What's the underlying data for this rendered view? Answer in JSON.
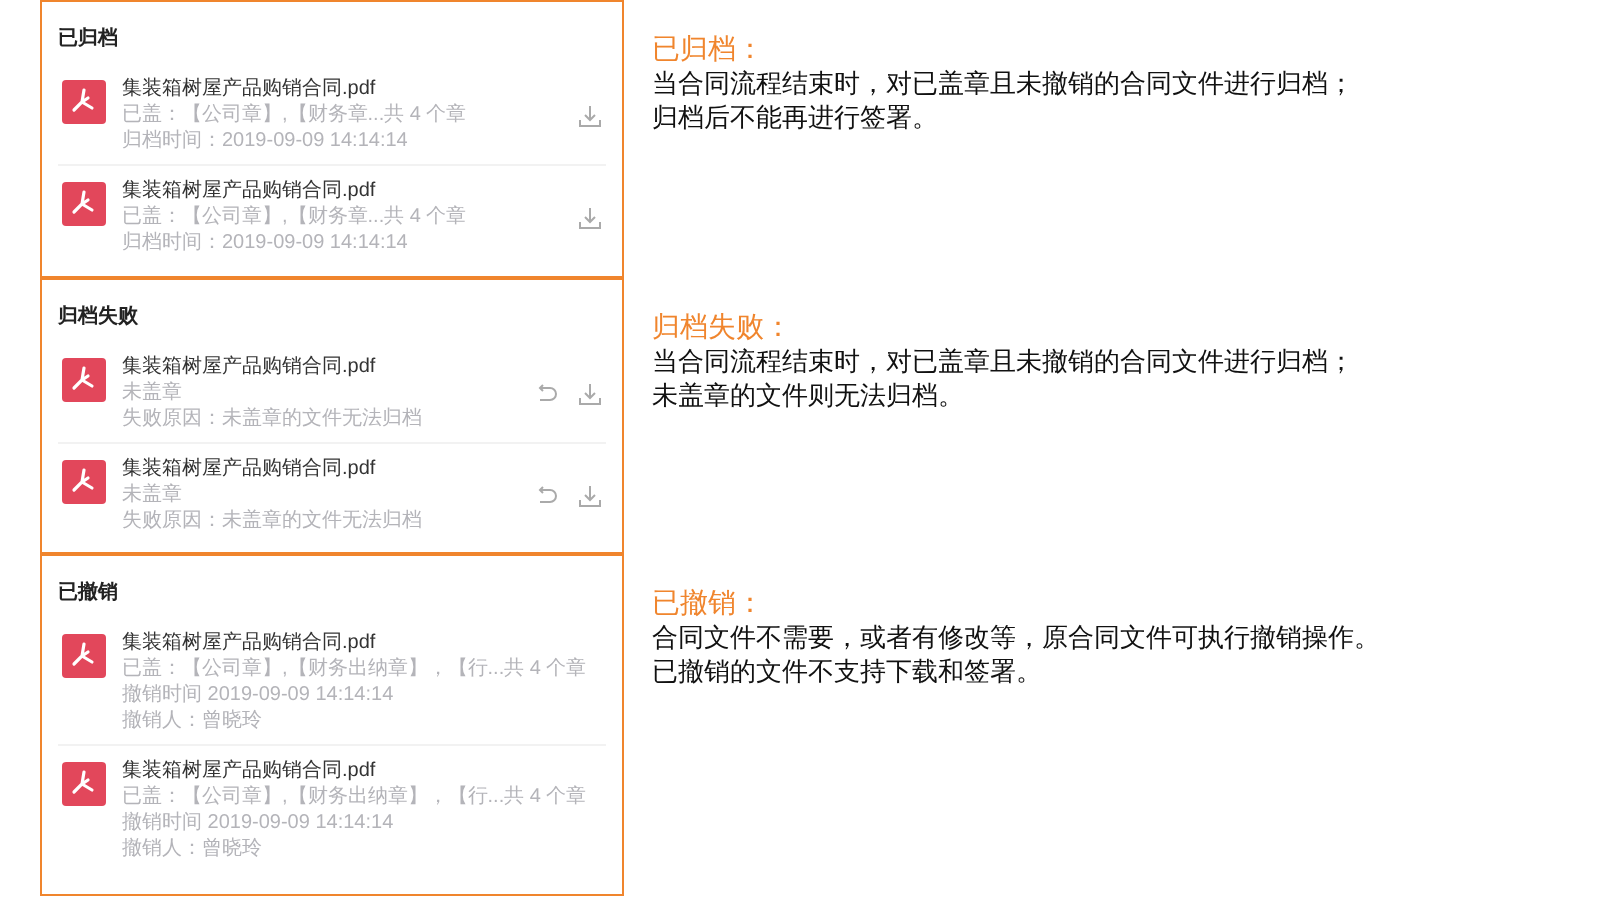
{
  "sections": [
    {
      "title": "已归档",
      "items": [
        {
          "name": "集装箱树屋产品购销合同.pdf",
          "meta": [
            "已盖：【公司章】,【财务章...共 4 个章",
            "归档时间：2019-09-09 14:14:14"
          ],
          "can_download": true
        },
        {
          "name": "集装箱树屋产品购销合同.pdf",
          "meta": [
            "已盖：【公司章】,【财务章...共 4 个章",
            "归档时间：2019-09-09 14:14:14"
          ],
          "can_download": true
        }
      ],
      "note": {
        "heading": "已归档：",
        "lines": [
          "当合同流程结束时，对已盖章且未撤销的合同文件进行归档；",
          "归档后不能再进行签署。"
        ]
      }
    },
    {
      "title": "归档失败",
      "items": [
        {
          "name": "集装箱树屋产品购销合同.pdf",
          "meta": [
            "未盖章",
            "失败原因：未盖章的文件无法归档"
          ],
          "can_undo": true,
          "can_download": true
        },
        {
          "name": "集装箱树屋产品购销合同.pdf",
          "meta": [
            "未盖章",
            "失败原因：未盖章的文件无法归档"
          ],
          "can_undo": true,
          "can_download": true
        }
      ],
      "note": {
        "heading": "归档失败：",
        "lines": [
          "当合同流程结束时，对已盖章且未撤销的合同文件进行归档；",
          "未盖章的文件则无法归档。"
        ]
      }
    },
    {
      "title": "已撤销",
      "items": [
        {
          "name": "集装箱树屋产品购销合同.pdf",
          "meta": [
            "已盖：【公司章】,【财务出纳章】，【行...共 4 个章",
            "撤销时间  2019-09-09  14:14:14",
            "撤销人：曾晓玲"
          ]
        },
        {
          "name": "集装箱树屋产品购销合同.pdf",
          "meta": [
            "已盖：【公司章】,【财务出纳章】，【行...共 4 个章",
            "撤销时间  2019-09-09  14:14:14",
            "撤销人：曾晓玲"
          ]
        }
      ],
      "note": {
        "heading": "已撤销：",
        "lines": [
          "合同文件不需要，或者有修改等，原合同文件可执行撤销操作。",
          "已撤销的文件不支持下载和签署。"
        ]
      }
    }
  ]
}
